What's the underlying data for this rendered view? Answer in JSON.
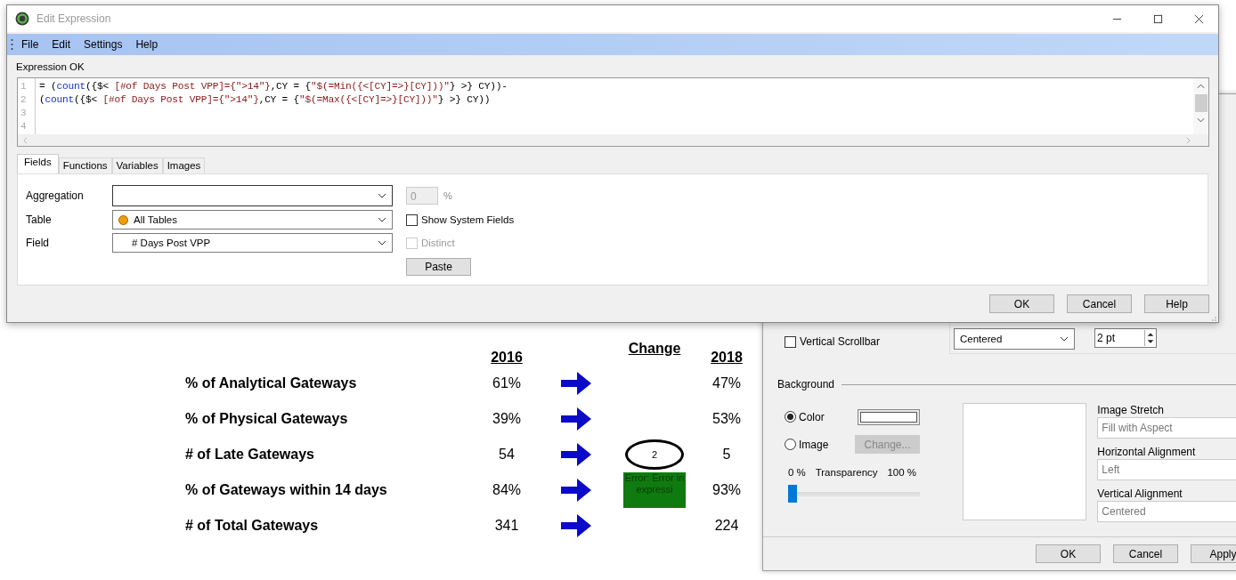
{
  "report": {
    "columns": [
      {
        "label": "2016"
      },
      {
        "label": "Change"
      },
      {
        "label": "2018"
      }
    ],
    "rows": [
      {
        "label": "% of Analytical Gateways",
        "v2016": "61%",
        "v2018": "47%"
      },
      {
        "label": "% of Physical Gateways",
        "v2016": "39%",
        "v2018": "53%"
      },
      {
        "label": "# of Late Gateways",
        "v2016": "54",
        "v2018": "5",
        "change": {
          "kind": "circled",
          "text": "2"
        }
      },
      {
        "label": "% of Gateways within 14 days",
        "v2016": "84%",
        "v2018": "93%",
        "change": {
          "kind": "error",
          "text": "Error: Error in expressi"
        }
      },
      {
        "label": "# of Total Gateways",
        "v2016": "341",
        "v2018": "224"
      }
    ]
  },
  "properties": {
    "scrollbar": {
      "label": "Vertical Scrollbar",
      "checked": false
    },
    "align_value": "Centered",
    "size_value": "2 pt",
    "background_title": "Background",
    "options": [
      {
        "label": "Color",
        "selected": true,
        "kind": "color"
      },
      {
        "label": "Image",
        "selected": false,
        "kind": "image",
        "button": "Change..."
      }
    ],
    "transparency": {
      "min": "0 %",
      "label": "Transparency",
      "max": "100 %",
      "level": 0
    },
    "image_settings": [
      {
        "label": "Image Stretch",
        "value": "Fill with Aspect"
      },
      {
        "label": "Horizontal Alignment",
        "value": "Left"
      },
      {
        "label": "Vertical Alignment",
        "value": "Centered"
      }
    ],
    "buttons": [
      "OK",
      "Cancel",
      "Apply"
    ]
  },
  "editor": {
    "title": "Edit Expression",
    "menu": [
      "File",
      "Edit",
      "Settings",
      "Help"
    ],
    "status": "Expression OK",
    "code": [
      {
        "number": "1",
        "segments": [
          {
            "text": "= (",
            "kind": "plain"
          },
          {
            "text": "count",
            "kind": "keyword"
          },
          {
            "text": "({$< ",
            "kind": "plain"
          },
          {
            "text": "[#of Days Post VPP]={\">14\"}",
            "kind": "string"
          },
          {
            "text": ",CY = {",
            "kind": "plain"
          },
          {
            "text": "\"$(=Min({<[CY]=>}[CY]))\"",
            "kind": "string"
          },
          {
            "text": "} >} CY))-",
            "kind": "plain"
          }
        ]
      },
      {
        "number": "2",
        "segments": [
          {
            "text": "(",
            "kind": "plain"
          },
          {
            "text": "count",
            "kind": "keyword"
          },
          {
            "text": "({$< ",
            "kind": "plain"
          },
          {
            "text": "[#of Days Post VPP]={\">14\"}",
            "kind": "string"
          },
          {
            "text": ",CY = {",
            "kind": "plain"
          },
          {
            "text": "\"$(=Max({<[CY]=>}[CY]))\"",
            "kind": "string"
          },
          {
            "text": "} >} CY))",
            "kind": "plain"
          }
        ]
      },
      {
        "number": "3"
      },
      {
        "number": "4"
      }
    ],
    "tabs": [
      {
        "label": "Fields",
        "selected": true
      },
      {
        "label": "Functions",
        "selected": false
      },
      {
        "label": "Variables",
        "selected": false
      },
      {
        "label": "Images",
        "selected": false
      }
    ],
    "aggregation": {
      "label": "Aggregation",
      "percent_value": "0",
      "percent_sign": "%"
    },
    "table": {
      "label": "Table",
      "value": "All Tables"
    },
    "field": {
      "label": "Field",
      "value": "# Days Post VPP"
    },
    "show_system_fields": {
      "label": "Show System Fields",
      "checked": false
    },
    "distinct": {
      "label": "Distinct",
      "checked": false,
      "disabled": true
    },
    "paste": "Paste",
    "buttons": [
      "OK",
      "Cancel",
      "Help"
    ]
  }
}
